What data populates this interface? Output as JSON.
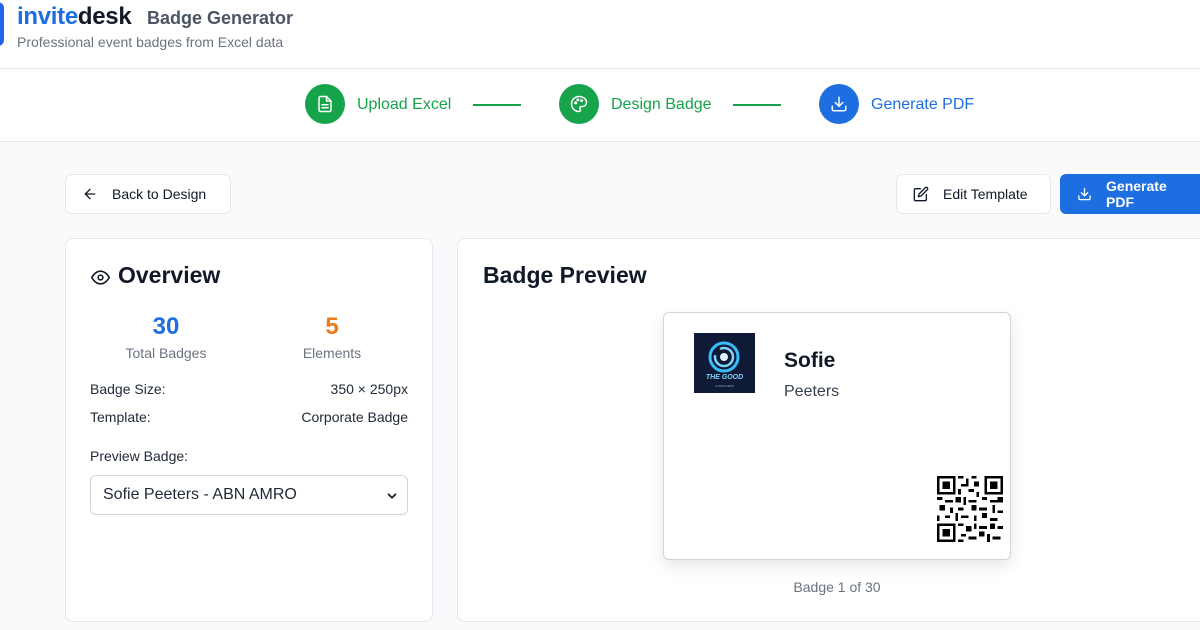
{
  "app": {
    "brand_part1": "invite",
    "brand_part2": "desk",
    "title": "Badge Generator",
    "subtitle": "Professional event badges from Excel data"
  },
  "stepper": {
    "steps": [
      {
        "label": "Upload Excel",
        "icon": "file-icon",
        "state": "done"
      },
      {
        "label": "Design Badge",
        "icon": "palette-icon",
        "state": "done"
      },
      {
        "label": "Generate PDF",
        "icon": "download-icon",
        "state": "active"
      }
    ]
  },
  "toolbar": {
    "back_label": "Back to Design",
    "edit_label": "Edit Template",
    "generate_label": "Generate PDF"
  },
  "overview": {
    "title": "Overview",
    "total_badges": "30",
    "total_badges_label": "Total Badges",
    "elements": "5",
    "elements_label": "Elements",
    "badge_size_label": "Badge Size:",
    "badge_size_value": "350 × 250px",
    "template_label": "Template:",
    "template_value": "Corporate Badge",
    "preview_label": "Preview Badge:",
    "preview_selected": "Sofie Peeters - ABN AMRO"
  },
  "preview": {
    "title": "Badge Preview",
    "first_name": "Sofie",
    "last_name": "Peeters",
    "logo_text": "THE GOOD",
    "logo_subtext": "& PARTNERS",
    "counter": "Badge 1 of 30"
  },
  "colors": {
    "primary": "#1d6ee0",
    "success": "#16a34a",
    "accent_orange": "#ea7a1a"
  }
}
